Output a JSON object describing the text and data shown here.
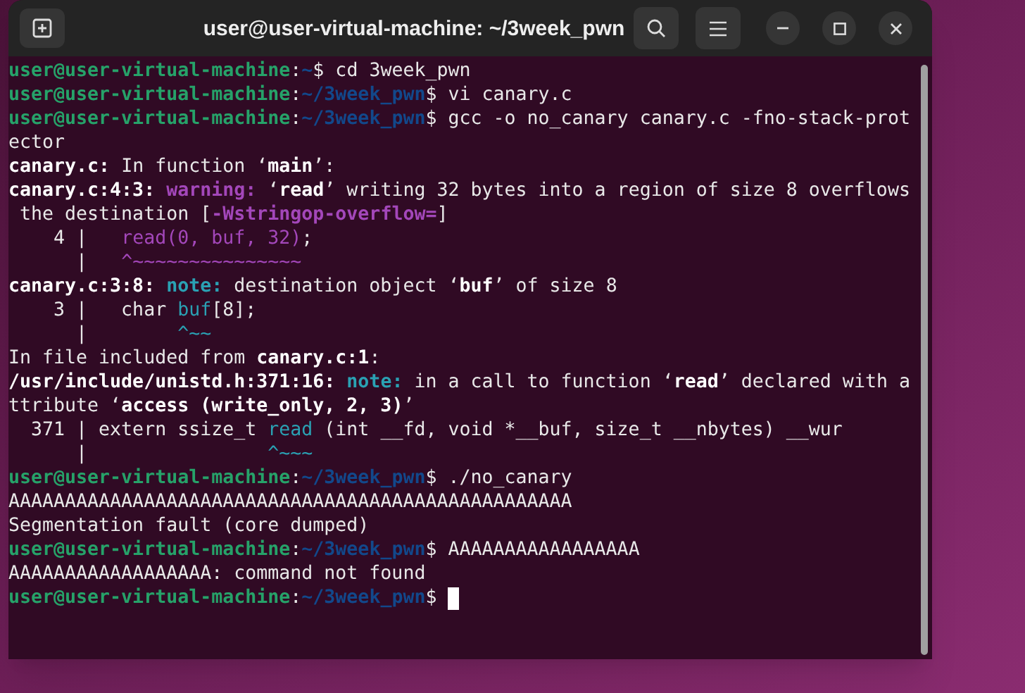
{
  "window": {
    "title": "user@user-virtual-machine: ~/3week_pwn"
  },
  "terminal": {
    "lines": [
      {
        "segments": [
          {
            "text": "user@user-virtual-machine",
            "kind": "user"
          },
          {
            "text": ":",
            "kind": "plain"
          },
          {
            "text": "~",
            "kind": "path"
          },
          {
            "text": "$ cd 3week_pwn",
            "kind": "plain"
          }
        ]
      },
      {
        "segments": [
          {
            "text": "user@user-virtual-machine",
            "kind": "user"
          },
          {
            "text": ":",
            "kind": "plain"
          },
          {
            "text": "~/3week_pwn",
            "kind": "path"
          },
          {
            "text": "$ vi canary.c",
            "kind": "plain"
          }
        ]
      },
      {
        "segments": [
          {
            "text": "user@user-virtual-machine",
            "kind": "user"
          },
          {
            "text": ":",
            "kind": "plain"
          },
          {
            "text": "~/3week_pwn",
            "kind": "path"
          },
          {
            "text": "$ gcc -o no_canary canary.c -fno-stack-prot",
            "kind": "plain"
          }
        ]
      },
      {
        "segments": [
          {
            "text": "ector",
            "kind": "plain"
          }
        ]
      },
      {
        "segments": [
          {
            "text": "canary.c:",
            "kind": "bold"
          },
          {
            "text": " In function ‘",
            "kind": "plain"
          },
          {
            "text": "main",
            "kind": "bold"
          },
          {
            "text": "’:",
            "kind": "plain"
          }
        ]
      },
      {
        "segments": [
          {
            "text": "canary.c:4:3: ",
            "kind": "bold"
          },
          {
            "text": "warning:",
            "kind": "warning"
          },
          {
            "text": " ‘",
            "kind": "plain"
          },
          {
            "text": "read",
            "kind": "bold"
          },
          {
            "text": "’ writing 32 bytes into a region of size 8 overflows",
            "kind": "plain"
          }
        ]
      },
      {
        "segments": [
          {
            "text": " the destination [",
            "kind": "plain"
          },
          {
            "text": "-Wstringop-overflow=",
            "kind": "warning"
          },
          {
            "text": "]",
            "kind": "plain"
          }
        ]
      },
      {
        "segments": [
          {
            "text": "    4 |   ",
            "kind": "plain"
          },
          {
            "text": "read(0, buf, 32)",
            "kind": "magenta"
          },
          {
            "text": ";",
            "kind": "plain"
          }
        ]
      },
      {
        "segments": [
          {
            "text": "      |   ",
            "kind": "plain"
          },
          {
            "text": "^~~~~~~~~~~~~~~~",
            "kind": "magenta"
          }
        ]
      },
      {
        "segments": [
          {
            "text": "canary.c:3:8: ",
            "kind": "bold"
          },
          {
            "text": "note:",
            "kind": "note"
          },
          {
            "text": " destination object ‘",
            "kind": "plain"
          },
          {
            "text": "buf",
            "kind": "bold"
          },
          {
            "text": "’ of size 8",
            "kind": "plain"
          }
        ]
      },
      {
        "segments": [
          {
            "text": "    3 |   char ",
            "kind": "plain"
          },
          {
            "text": "buf",
            "kind": "cyan"
          },
          {
            "text": "[8];",
            "kind": "plain"
          }
        ]
      },
      {
        "segments": [
          {
            "text": "      |        ",
            "kind": "plain"
          },
          {
            "text": "^~~",
            "kind": "cyan"
          }
        ]
      },
      {
        "segments": [
          {
            "text": "In file included from ",
            "kind": "plain"
          },
          {
            "text": "canary.c:1",
            "kind": "bold"
          },
          {
            "text": ":",
            "kind": "plain"
          }
        ]
      },
      {
        "segments": [
          {
            "text": "/usr/include/unistd.h:371:16: ",
            "kind": "bold"
          },
          {
            "text": "note:",
            "kind": "note"
          },
          {
            "text": " in a call to function ‘",
            "kind": "plain"
          },
          {
            "text": "read",
            "kind": "bold"
          },
          {
            "text": "’ declared with a",
            "kind": "plain"
          }
        ]
      },
      {
        "segments": [
          {
            "text": "ttribute ‘",
            "kind": "plain"
          },
          {
            "text": "access (write_only, 2, 3)",
            "kind": "bold"
          },
          {
            "text": "’",
            "kind": "plain"
          }
        ]
      },
      {
        "segments": [
          {
            "text": "  371 | extern ssize_t ",
            "kind": "plain"
          },
          {
            "text": "read",
            "kind": "cyan"
          },
          {
            "text": " (int __fd, void *__buf, size_t __nbytes) __wur",
            "kind": "plain"
          }
        ]
      },
      {
        "segments": [
          {
            "text": "      |                ",
            "kind": "plain"
          },
          {
            "text": "^~~~",
            "kind": "cyan"
          }
        ]
      },
      {
        "segments": [
          {
            "text": "user@user-virtual-machine",
            "kind": "user"
          },
          {
            "text": ":",
            "kind": "plain"
          },
          {
            "text": "~/3week_pwn",
            "kind": "path"
          },
          {
            "text": "$ ./no_canary",
            "kind": "plain"
          }
        ]
      },
      {
        "segments": [
          {
            "text": "AAAAAAAAAAAAAAAAAAAAAAAAAAAAAAAAAAAAAAAAAAAAAAAAAA",
            "kind": "plain"
          }
        ]
      },
      {
        "segments": [
          {
            "text": "Segmentation fault (core dumped)",
            "kind": "plain"
          }
        ]
      },
      {
        "segments": [
          {
            "text": "user@user-virtual-machine",
            "kind": "user"
          },
          {
            "text": ":",
            "kind": "plain"
          },
          {
            "text": "~/3week_pwn",
            "kind": "path"
          },
          {
            "text": "$ AAAAAAAAAAAAAAAAA",
            "kind": "plain"
          }
        ]
      },
      {
        "segments": [
          {
            "text": "AAAAAAAAAAAAAAAAAA: command not found",
            "kind": "plain"
          }
        ]
      },
      {
        "segments": [
          {
            "text": "user@user-virtual-machine",
            "kind": "user"
          },
          {
            "text": ":",
            "kind": "plain"
          },
          {
            "text": "~/3week_pwn",
            "kind": "path"
          },
          {
            "text": "$ ",
            "kind": "plain"
          }
        ],
        "cursor": true
      }
    ]
  }
}
